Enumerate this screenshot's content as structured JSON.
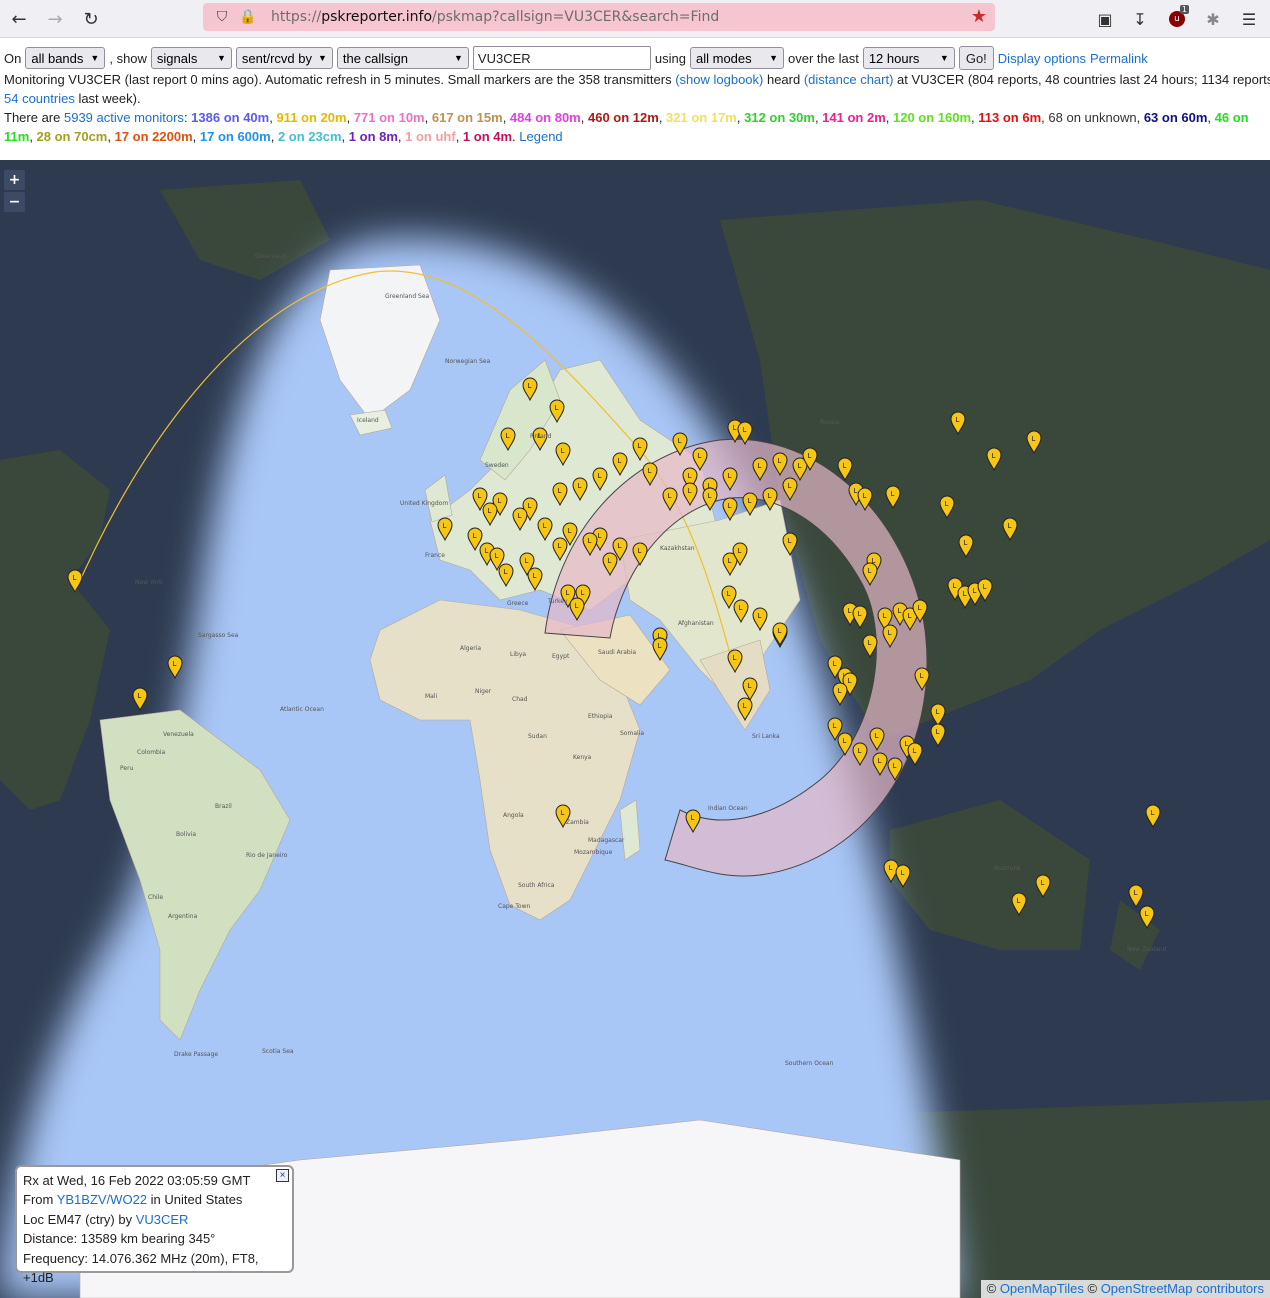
{
  "browser": {
    "url_prefix": "https://",
    "url_host": "pskreporter.info",
    "url_path": "/pskmap?callsign=VU3CER&search=Find",
    "badge": "1"
  },
  "controls": {
    "on_label": "On",
    "band": "all bands",
    "show_label": ", show",
    "show_what": "signals",
    "direction": "sent/rcvd by",
    "subject": "the callsign",
    "callsign": "VU3CER",
    "using_label": "using",
    "mode": "all modes",
    "over_label": "over the last",
    "period": "12 hours",
    "go": "Go!",
    "display_options": "Display options",
    "permalink": "Permalink"
  },
  "status": {
    "monitoring_1": "Monitoring VU3CER (last report 0 mins ago). Automatic refresh in 5 minutes. Small markers are the 358 transmitters ",
    "show_logbook": "(show logbook)",
    "heard": " heard ",
    "distance_chart": "(distance chart)",
    "monitoring_2": " at VU3CER (804 reports, 48 countries last 24 hours; 1134 reports,",
    "countries_link": "54 countries",
    "monitoring_3": " last week).",
    "there_are": "There are ",
    "active_monitors": "5939 active monitors",
    "legend": "Legend"
  },
  "bands": [
    {
      "label": "1386 on 40m",
      "color": "#5a5af0"
    },
    {
      "label": "911 on 20m",
      "color": "#e6b800"
    },
    {
      "label": "771 on 10m",
      "color": "#f070c0"
    },
    {
      "label": "617 on 15m",
      "color": "#c09050"
    },
    {
      "label": "484 on 80m",
      "color": "#e040e0"
    },
    {
      "label": "460 on 12m",
      "color": "#b01818"
    },
    {
      "label": "321 on 17m",
      "color": "#f0e060"
    },
    {
      "label": "312 on 30m",
      "color": "#30d030"
    },
    {
      "label": "141 on 2m",
      "color": "#f02090"
    },
    {
      "label": "120 on 160m",
      "color": "#60e020"
    },
    {
      "label": "113 on 6m",
      "color": "#e01010"
    },
    {
      "label": "68 on unknown",
      "color": "#333333",
      "plain": true
    },
    {
      "label": "63 on 60m",
      "color": "#101080"
    },
    {
      "label": "46 on 11m",
      "color": "#20e020"
    },
    {
      "label": "28 on 70cm",
      "color": "#a0a020"
    },
    {
      "label": "17 on 2200m",
      "color": "#e05010"
    },
    {
      "label": "17 on 600m",
      "color": "#2090f0"
    },
    {
      "label": "2 on 23cm",
      "color": "#40c0d0"
    },
    {
      "label": "1 on 8m",
      "color": "#7020c0"
    },
    {
      "label": "1 on uhf",
      "color": "#f0a0a0"
    },
    {
      "label": "1 on 4m",
      "color": "#c01060"
    }
  ],
  "map_labels": [
    "Greenland",
    "Greenland Sea",
    "Norwegian Sea",
    "Iceland",
    "Finland",
    "Sweden",
    "United Kingdom",
    "France",
    "Kazakhstan",
    "Afghanistan",
    "Turkey",
    "Greece",
    "Algeria",
    "Libya",
    "Egypt",
    "Saudi Arabia",
    "Mali",
    "Niger",
    "Chad",
    "Sudan",
    "Ethiopia",
    "Somalia",
    "Kenya",
    "Angola",
    "Zambia",
    "Mozambique",
    "Madagascar",
    "South Africa",
    "Cape Town",
    "Indian Ocean",
    "Atlantic Ocean",
    "Sargasso Sea",
    "Venezuela",
    "Colombia",
    "Brazil",
    "Peru",
    "Bolivia",
    "Chile",
    "Argentina",
    "Rio de Janeiro",
    "Drake Passage",
    "Scotia Sea",
    "Southern Ocean",
    "Australia",
    "New Zealand",
    "Sri Lanka",
    "New York",
    "Russia"
  ],
  "popup": {
    "line1": "Rx at Wed, 16 Feb 2022 03:05:59 GMT",
    "from_label": "From ",
    "from_call": "YB1BZV/WO22",
    "from_suffix": " in United States",
    "loc_label": "Loc EM47 (ctry) by ",
    "loc_call": "VU3CER",
    "distance": "Distance: 13589 km bearing 345°",
    "frequency": "Frequency: 14.076.362 MHz (20m), FT8, +1dB",
    "close": "×"
  },
  "attribution": {
    "copy": "© ",
    "omt": "OpenMapTiles",
    "copy2": " © ",
    "osm": "OpenStreetMap contributors"
  },
  "zoom": {
    "in": "+",
    "out": "−"
  }
}
